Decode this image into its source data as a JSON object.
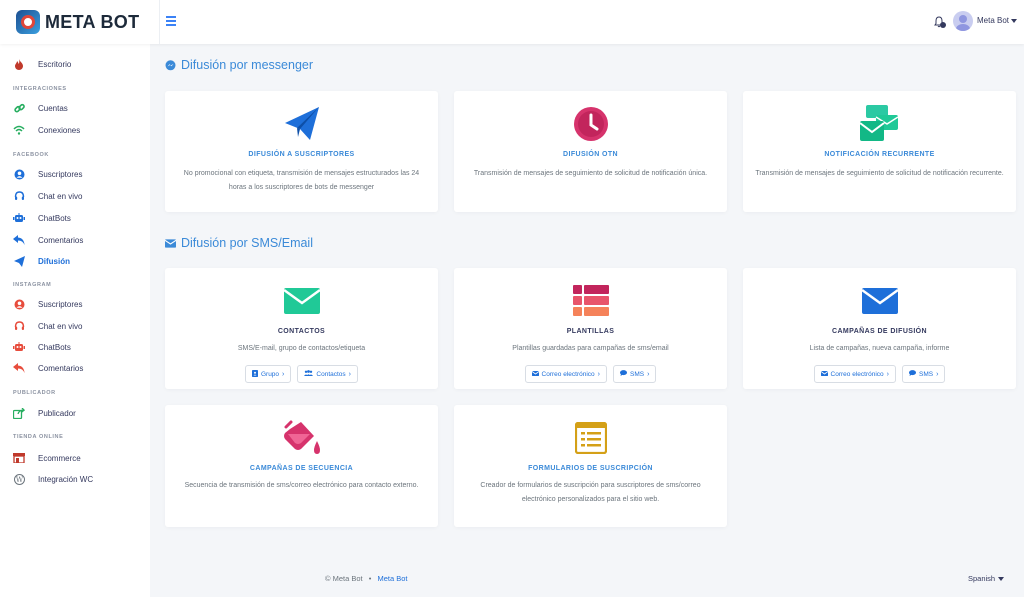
{
  "header": {
    "logo_text": "META BOT",
    "user_name": "Meta Bot"
  },
  "sidebar": {
    "items": [
      {
        "label": "Escritorio",
        "icon": "fire-icon",
        "color": "#c0392b"
      },
      {
        "header": "INTEGRACIONES"
      },
      {
        "label": "Cuentas",
        "icon": "link-icon",
        "color": "#27ae60"
      },
      {
        "label": "Conexiones",
        "icon": "wifi-icon",
        "color": "#27ae60"
      },
      {
        "header": "FACEBOOK"
      },
      {
        "label": "Suscriptores",
        "icon": "user-circle-icon",
        "color": "#1e6fd9"
      },
      {
        "label": "Chat en vivo",
        "icon": "headset-icon",
        "color": "#1e6fd9"
      },
      {
        "label": "ChatBots",
        "icon": "robot-icon",
        "color": "#1e6fd9"
      },
      {
        "label": "Comentarios",
        "icon": "reply-icon",
        "color": "#1e6fd9"
      },
      {
        "label": "Difusión",
        "icon": "paper-plane-icon",
        "color": "#1e6fd9",
        "active": true
      },
      {
        "header": "INSTAGRAM"
      },
      {
        "label": "Suscriptores",
        "icon": "user-circle-icon",
        "color": "#e74c3c"
      },
      {
        "label": "Chat en vivo",
        "icon": "headset-icon",
        "color": "#e74c3c"
      },
      {
        "label": "ChatBots",
        "icon": "robot-icon",
        "color": "#e74c3c"
      },
      {
        "label": "Comentarios",
        "icon": "reply-icon",
        "color": "#e74c3c"
      },
      {
        "header": "PUBLICADOR"
      },
      {
        "label": "Publicador",
        "icon": "share-square-icon",
        "color": "#27ae60"
      },
      {
        "header": "TIENDA ONLINE"
      },
      {
        "label": "Ecommerce",
        "icon": "store-icon",
        "color": "#c0392b"
      },
      {
        "label": "Integración WC",
        "icon": "wordpress-icon",
        "color": "#6c757d"
      }
    ]
  },
  "sections": [
    {
      "title": "Difusión por messenger",
      "icon": "messenger-icon"
    },
    {
      "title": "Difusión por SMS/Email",
      "icon": "envelope-icon"
    }
  ],
  "cards": [
    {
      "title": "DIFUSIÓN A SUSCRIPTORES",
      "desc": "No promocional con etiqueta, transmisión de mensajes estructurados las 24 horas a los suscriptores de bots de messenger",
      "icon": "paper-plane-icon",
      "color": "#1e6fd9"
    },
    {
      "title": "DIFUSIÓN OTN",
      "desc": "Transmisión de mensajes de seguimiento de solicitud de notificación única.",
      "icon": "clock-icon",
      "color": "#d6336c"
    },
    {
      "title": "NOTIFICACIÓN RECURRENTE",
      "desc": "Transmisión de mensajes de seguimiento de solicitud de notificación recurrente.",
      "icon": "mail-bulk-icon",
      "color": "#20c997"
    },
    {
      "title": "CONTACTOS",
      "desc": "SMS/E-mail, grupo de contactos/etiqueta",
      "icon": "envelope-icon",
      "color": "#20c997",
      "buttons": [
        {
          "label": "Grupo",
          "icon": "address-book-icon"
        },
        {
          "label": "Contactos",
          "icon": "users-icon"
        }
      ]
    },
    {
      "title": "PLANTILLAS",
      "desc": "Plantillas guardadas para campañas de sms/email",
      "icon": "th-list-icon",
      "color": "#e8556b",
      "buttons": [
        {
          "label": "Correo electrónico",
          "icon": "envelope-icon"
        },
        {
          "label": "SMS",
          "icon": "comment-icon"
        }
      ]
    },
    {
      "title": "CAMPAÑAS DE DIFUSIÓN",
      "desc": "Lista de campañas, nueva campaña, informe",
      "icon": "envelope-icon",
      "color": "#1e6fd9",
      "buttons": [
        {
          "label": "Correo electrónico",
          "icon": "envelope-icon"
        },
        {
          "label": "SMS",
          "icon": "comment-icon"
        }
      ]
    },
    {
      "title": "CAMPAÑAS DE SECUENCIA",
      "desc": "Secuencia de transmisión de sms/correo electrónico para contacto externo.",
      "icon": "fill-drip-icon",
      "color": "#d6336c"
    },
    {
      "title": "FORMULARIOS DE SUSCRIPCIÓN",
      "desc": "Creador de formularios de suscripción para suscriptores de sms/correo electrónico personalizados para el sitio web.",
      "icon": "form-icon",
      "color": "#d4a017"
    }
  ],
  "footer": {
    "copyright": "© Meta Bot",
    "separator": "•",
    "link": "Meta Bot",
    "language": "Spanish"
  }
}
